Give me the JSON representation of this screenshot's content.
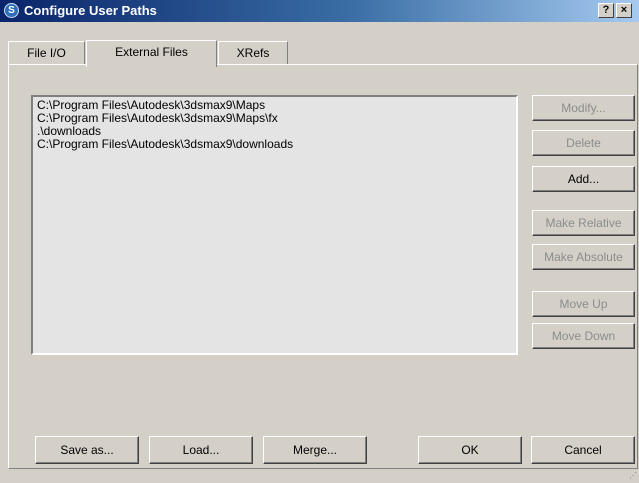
{
  "window": {
    "title": "Configure User Paths",
    "help_label": "?",
    "close_label": "×"
  },
  "tabs": [
    {
      "label": "File I/O",
      "active": false
    },
    {
      "label": "External Files",
      "active": true
    },
    {
      "label": "XRefs",
      "active": false
    }
  ],
  "paths": [
    "C:\\Program Files\\Autodesk\\3dsmax9\\Maps",
    "C:\\Program Files\\Autodesk\\3dsmax9\\Maps\\fx",
    ".\\downloads",
    "C:\\Program Files\\Autodesk\\3dsmax9\\downloads"
  ],
  "side_buttons": {
    "modify": "Modify...",
    "delete": "Delete",
    "add": "Add...",
    "make_relative": "Make Relative",
    "make_absolute": "Make Absolute",
    "move_up": "Move Up",
    "move_down": "Move Down"
  },
  "bottom_buttons": {
    "save_as": "Save as...",
    "load": "Load...",
    "merge": "Merge...",
    "ok": "OK",
    "cancel": "Cancel"
  },
  "icons": {
    "app": "3dsmax-app-icon",
    "resize": "resize-grip-icon"
  }
}
